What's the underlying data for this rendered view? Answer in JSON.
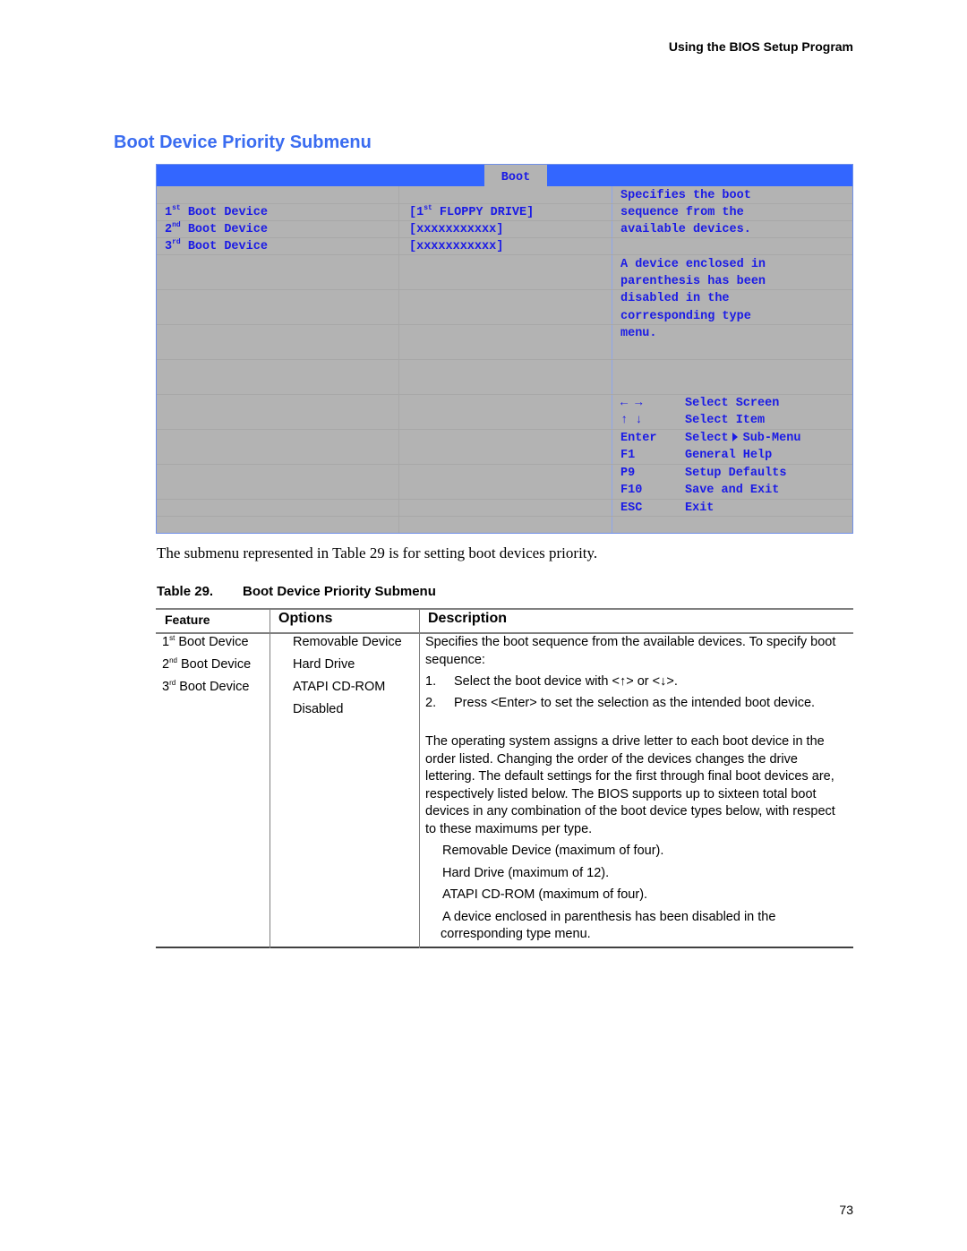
{
  "running_header": "Using the BIOS Setup Program",
  "section_title": "Boot Device Priority Submenu",
  "bios_screen": {
    "active_tab": "Boot",
    "items": [
      {
        "ordinal": "1",
        "suffix": "st",
        "label": "Boot Device",
        "value_prefix": "[1",
        "value_suffix": "st",
        "value_rest": " FLOPPY DRIVE]"
      },
      {
        "ordinal": "2",
        "suffix": "nd",
        "label": "Boot Device",
        "value": "[xxxxxxxxxxx]"
      },
      {
        "ordinal": "3",
        "suffix": "rd",
        "label": "Boot Device",
        "value": "[xxxxxxxxxxx]"
      }
    ],
    "help_text": [
      "Specifies the boot",
      "sequence from the",
      "available devices.",
      "",
      "A device enclosed in",
      "parenthesis has been",
      "disabled in the",
      "corresponding type",
      "menu."
    ],
    "key_legend": [
      {
        "key": "← →",
        "action": "Select Screen"
      },
      {
        "key": "↑ ↓",
        "action": "Select Item"
      },
      {
        "key": "Enter",
        "action_prefix": "Select",
        "action_suffix": "Sub-Menu",
        "icon": "right-triangle-icon"
      },
      {
        "key": "F1",
        "action": "General Help"
      },
      {
        "key": "P9",
        "action": "Setup Defaults"
      },
      {
        "key": "F10",
        "action": "Save and Exit"
      },
      {
        "key": "ESC",
        "action": "Exit"
      }
    ]
  },
  "body_text": "The submenu represented in Table 29 is for setting boot devices priority.",
  "table": {
    "caption_number": "Table 29.",
    "caption_title": "Boot Device Priority Submenu",
    "headers": {
      "feature": "Feature",
      "options": "Options",
      "description": "Description"
    },
    "features": [
      {
        "ordinal": "1",
        "suffix": "st",
        "label": " Boot Device"
      },
      {
        "ordinal": "2",
        "suffix": "nd",
        "label": " Boot Device"
      },
      {
        "ordinal": "3",
        "suffix": "rd",
        "label": " Boot Device"
      }
    ],
    "options": [
      "Removable Device",
      "Hard Drive",
      "ATAPI CD-ROM",
      "Disabled"
    ],
    "description": {
      "intro": "Specifies the boot sequence from the available devices.  To specify boot sequence:",
      "steps": [
        {
          "n": "1.",
          "text": "Select the boot device with <↑> or <↓>."
        },
        {
          "n": "2.",
          "text": "Press <Enter> to set the selection as the intended boot device."
        }
      ],
      "paragraph": "The operating system assigns a drive letter to each boot device in the order listed.  Changing the order of the devices changes the drive lettering.  The default settings for the first through final boot devices are, respectively listed below.  The BIOS supports up to sixteen total boot devices in any combination of the boot device types below, with respect to these maximums per type.",
      "bullets": [
        "Removable Device (maximum of four).",
        "Hard Drive (maximum of 12).",
        "ATAPI CD-ROM (maximum of four)."
      ],
      "note_line1": "A device enclosed in parenthesis has been disabled in the",
      "note_line2": "corresponding type menu."
    }
  },
  "page_number": "73",
  "colors": {
    "title_blue": "#3a6cf0",
    "bios_bar_blue": "#3366ff",
    "bios_text_blue": "#1a1ae6",
    "bios_gray": "#b3b3b3"
  }
}
